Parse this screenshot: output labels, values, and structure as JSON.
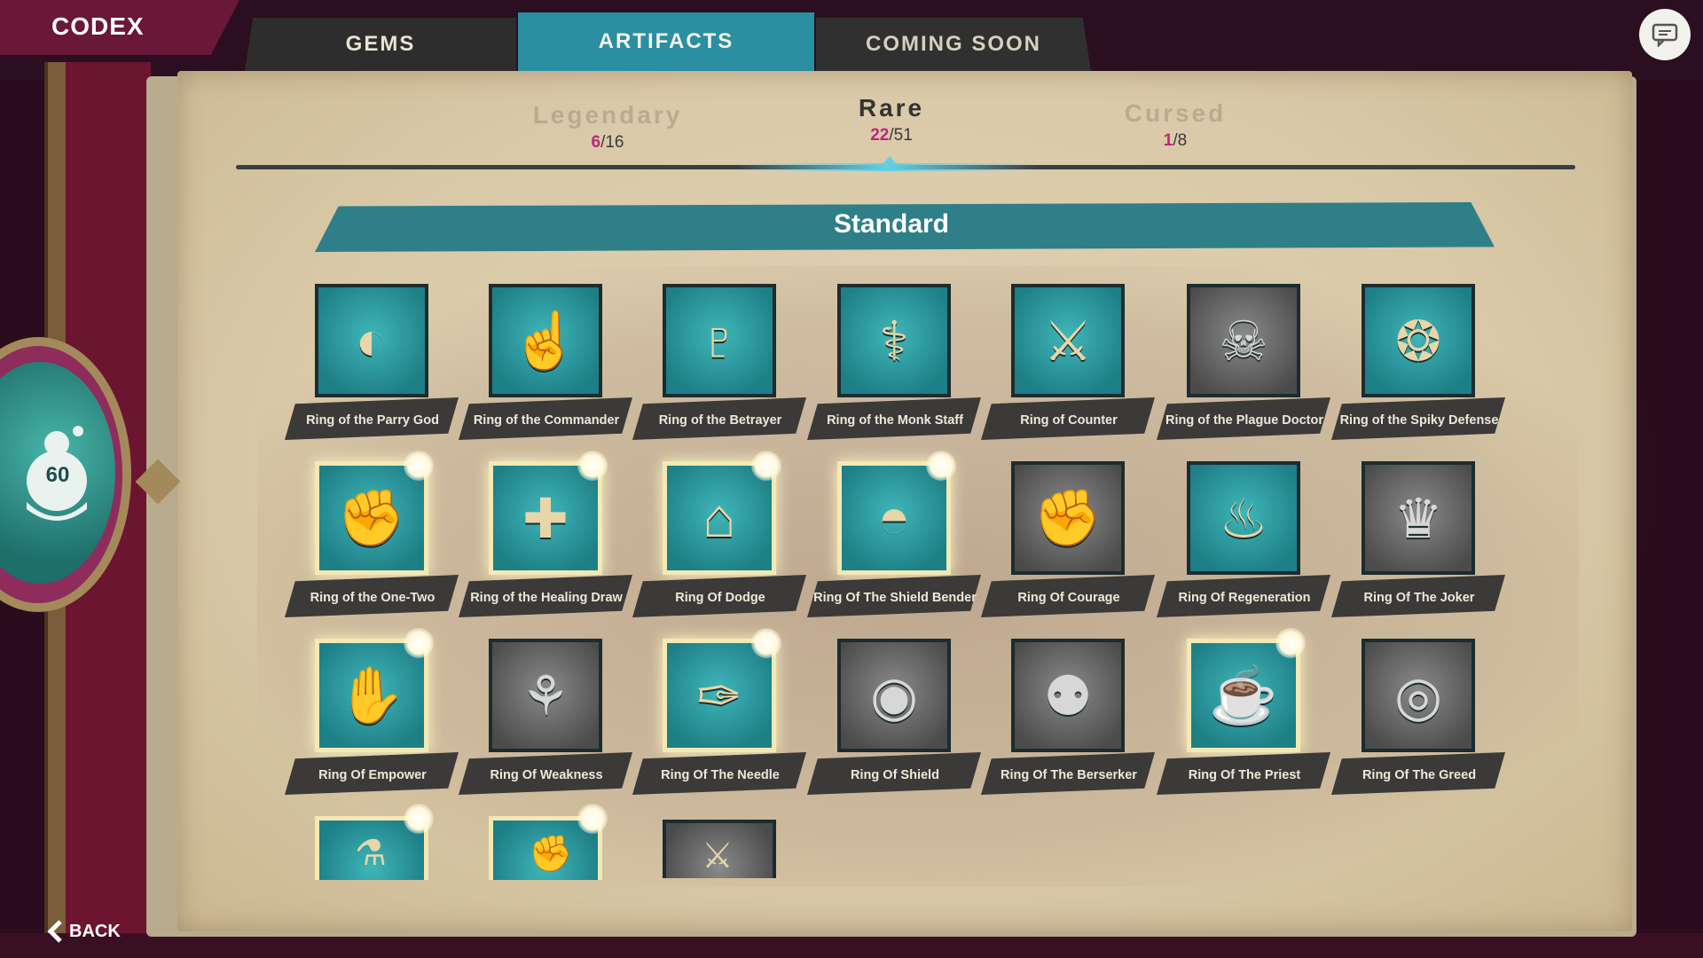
{
  "header": {
    "title": "CODEX"
  },
  "tabs": [
    {
      "label": "GEMS",
      "active": false
    },
    {
      "label": "ARTIFACTS",
      "active": true
    },
    {
      "label": "COMING SOON",
      "active": false
    }
  ],
  "emblem": {
    "value": "60"
  },
  "categories": [
    {
      "name": "Legendary",
      "got": "6",
      "total": "/16",
      "active": false
    },
    {
      "name": "Rare",
      "got": "22",
      "total": "/51",
      "active": true
    },
    {
      "name": "Cursed",
      "got": "1",
      "total": "/8",
      "active": false
    }
  ],
  "section": {
    "title": "Standard"
  },
  "items": [
    {
      "label": "Ring of the Parry God",
      "icon": "shield-arm-icon",
      "style": "teal"
    },
    {
      "label": "Ring of the Commander",
      "icon": "pointing-hand-icon",
      "style": "teal"
    },
    {
      "label": "Ring of the Betrayer",
      "icon": "dark-helm-icon",
      "style": "teal"
    },
    {
      "label": "Ring of the Monk Staff",
      "icon": "staff-icon",
      "style": "teal"
    },
    {
      "label": "Ring of Counter",
      "icon": "crossed-swords-icon",
      "style": "teal"
    },
    {
      "label": "Ring of the Plague Doctor",
      "icon": "plague-mask-icon",
      "style": "gray"
    },
    {
      "label": "Ring of the Spiky Defense",
      "icon": "spiked-helmet-icon",
      "style": "teal"
    },
    {
      "label": "Ring of the One-Two",
      "icon": "gauntlet-icon",
      "style": "glow"
    },
    {
      "label": "Ring of the Healing Draw",
      "icon": "healing-card-icon",
      "style": "glow"
    },
    {
      "label": "Ring Of Dodge",
      "icon": "hat-icon",
      "style": "glow"
    },
    {
      "label": "Ring Of The Shield Bender",
      "icon": "magic-shield-icon",
      "style": "glow"
    },
    {
      "label": "Ring Of Courage",
      "icon": "fist-icon",
      "style": "gray"
    },
    {
      "label": "Ring Of Regeneration",
      "icon": "flame-icon",
      "style": "teal"
    },
    {
      "label": "Ring Of The Joker",
      "icon": "jester-hat-icon",
      "style": "gray"
    },
    {
      "label": "Ring Of Empower",
      "icon": "flexed-arm-icon",
      "style": "glow"
    },
    {
      "label": "Ring Of Weakness",
      "icon": "cat-icon",
      "style": "gray"
    },
    {
      "label": "Ring Of The Needle",
      "icon": "needle-icon",
      "style": "glow"
    },
    {
      "label": "Ring Of Shield",
      "icon": "round-shield-icon",
      "style": "gray"
    },
    {
      "label": "Ring Of The Berserker",
      "icon": "bear-icon",
      "style": "gray"
    },
    {
      "label": "Ring Of The Priest",
      "icon": "chalice-icon",
      "style": "glow"
    },
    {
      "label": "Ring Of The Greed",
      "icon": "money-bag-icon",
      "style": "gray"
    }
  ],
  "partial_items": [
    {
      "icon": "potion-icon",
      "style": "glow"
    },
    {
      "icon": "boxing-glove-icon",
      "style": "glow"
    },
    {
      "icon": "blade-icon",
      "style": "gray"
    }
  ],
  "footer": {
    "back_label": "BACK"
  }
}
